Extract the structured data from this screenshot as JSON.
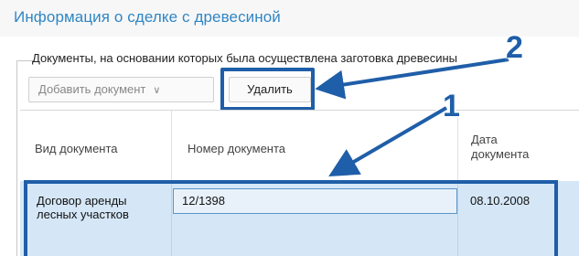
{
  "page": {
    "title": "Информация о сделке с древесиной"
  },
  "fieldset": {
    "legend": "Документы, на основании которых была осуществлена заготовка древесины"
  },
  "toolbar": {
    "add_label": "Добавить документ",
    "delete_label": "Удалить"
  },
  "table": {
    "columns": [
      "Вид документа",
      "Номер документа",
      "Дата документа"
    ],
    "rows": [
      {
        "type": "Договор аренды лесных участков",
        "number": "12/1398",
        "date": "08.10.2008"
      }
    ]
  },
  "annotations": {
    "callout_1": "1",
    "callout_2": "2",
    "highlight_color": "#1f5ea8"
  },
  "colors": {
    "accent": "#2f86c5",
    "selected_row": "#d5e7f7"
  }
}
